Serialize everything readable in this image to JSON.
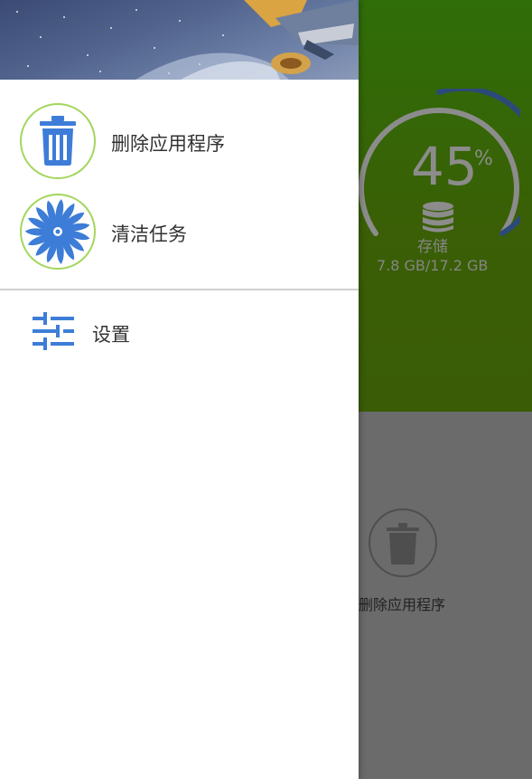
{
  "background": {
    "storage_percent": "45",
    "percent_sign": "%",
    "storage_fraction": 0.45,
    "storage_label": "存储",
    "storage_value": "7.8 GB/17.2 GB",
    "uninstall_label": "删除应用程序"
  },
  "drawer": {
    "items": [
      {
        "label": "删除应用程序",
        "icon": "trash-icon"
      },
      {
        "label": "清洁任务",
        "icon": "fan-icon"
      }
    ],
    "settings": {
      "label": "设置",
      "icon": "sliders-icon"
    }
  },
  "colors": {
    "accent_green": "#a4d65e",
    "icon_blue": "#3d7dd8",
    "gauge_track": "#8c8c8c",
    "gauge_fill": "#2c4a78"
  }
}
